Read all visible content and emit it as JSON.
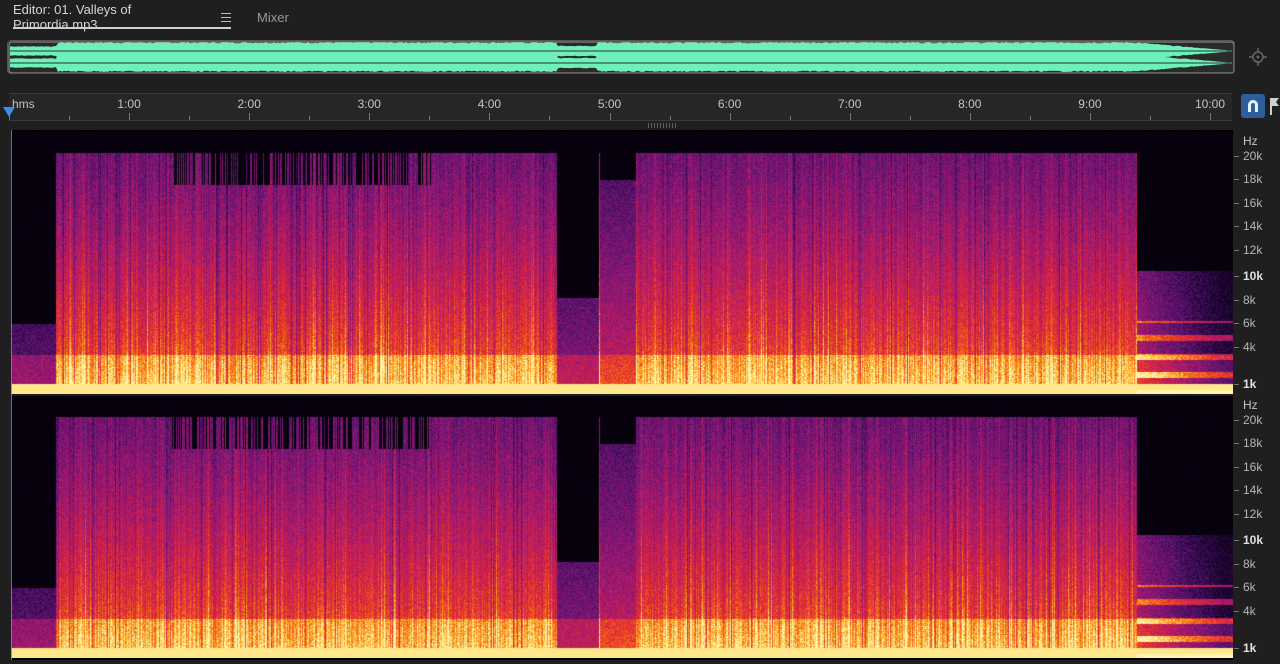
{
  "tabs": {
    "editor_label": "Editor: 01. Valleys of Primordia.mp3",
    "mixer_label": "Mixer"
  },
  "ruler": {
    "unit_label": "hms",
    "time_labels": [
      "1:00",
      "2:00",
      "3:00",
      "4:00",
      "5:00",
      "6:00",
      "7:00",
      "8:00",
      "9:00",
      "10:00"
    ],
    "duration_seconds": 610
  },
  "spectral": {
    "unit_label": "Hz",
    "freq_labels": [
      "20k",
      "18k",
      "16k",
      "14k",
      "12k",
      "10k",
      "8k",
      "6k",
      "4k",
      "1k"
    ],
    "emphasized_label": "10k"
  },
  "colors": {
    "waveform": "#6ff0b8",
    "accent": "#3a8ee6",
    "background": "#1f1f1f"
  },
  "icons": {
    "tab_menu": "hamburger-menu-icon",
    "zoom_nav": "zoom-navigator-icon",
    "snap": "magnet-icon",
    "marker": "marker-flag-icon"
  }
}
